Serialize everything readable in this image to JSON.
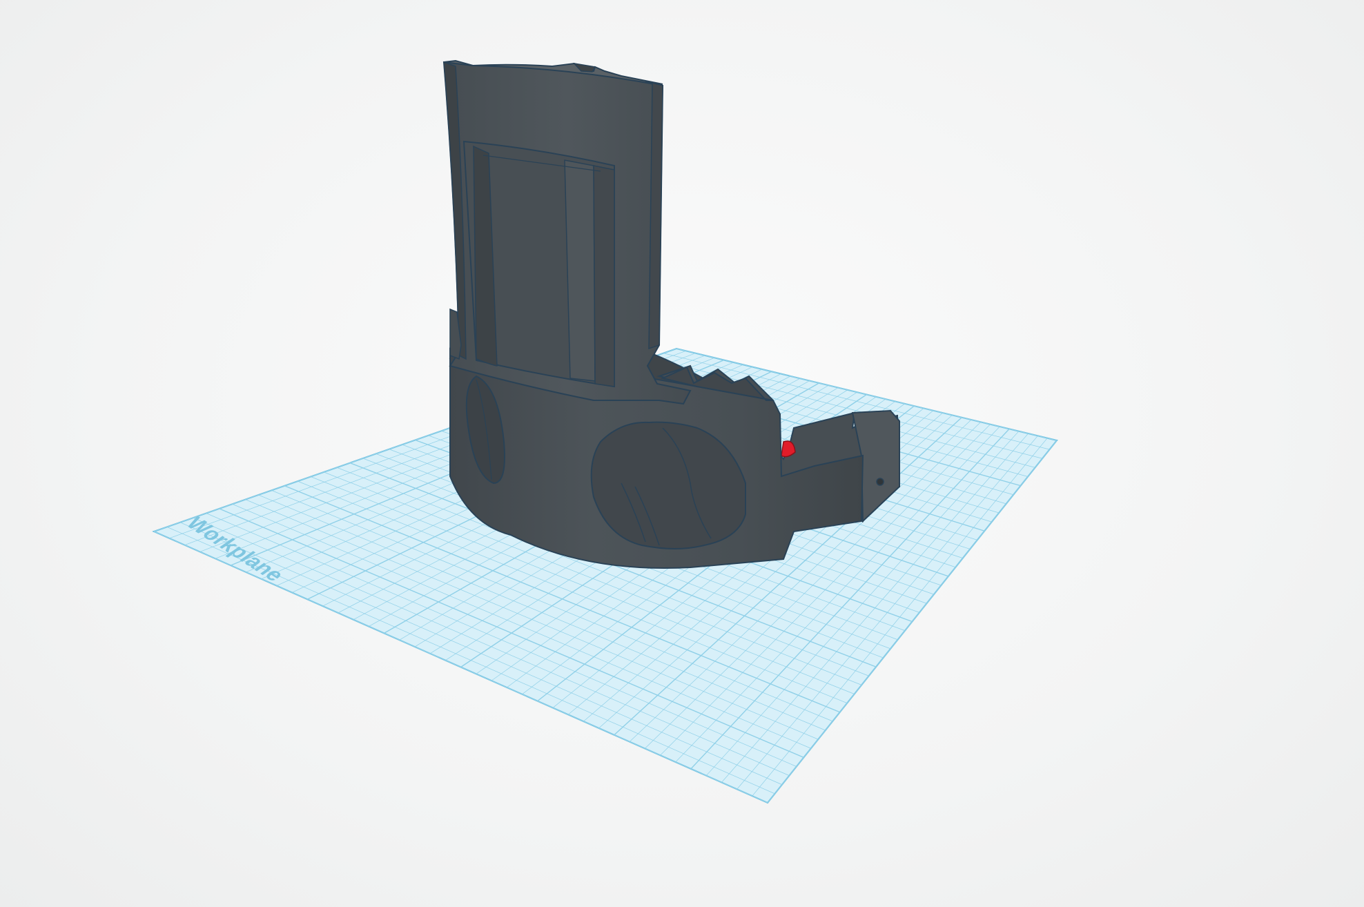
{
  "workplane": {
    "label": "Workplane",
    "grid_color": "#8fd0e8",
    "plane_color": "#d8f0f9",
    "edge_color": "#5bb7dc"
  },
  "model": {
    "body_color": "#4a5156",
    "body_shade": "#3d4347",
    "body_light": "#5a6166",
    "outline_color": "#2a4256",
    "accent_color": "#e01c2a"
  }
}
